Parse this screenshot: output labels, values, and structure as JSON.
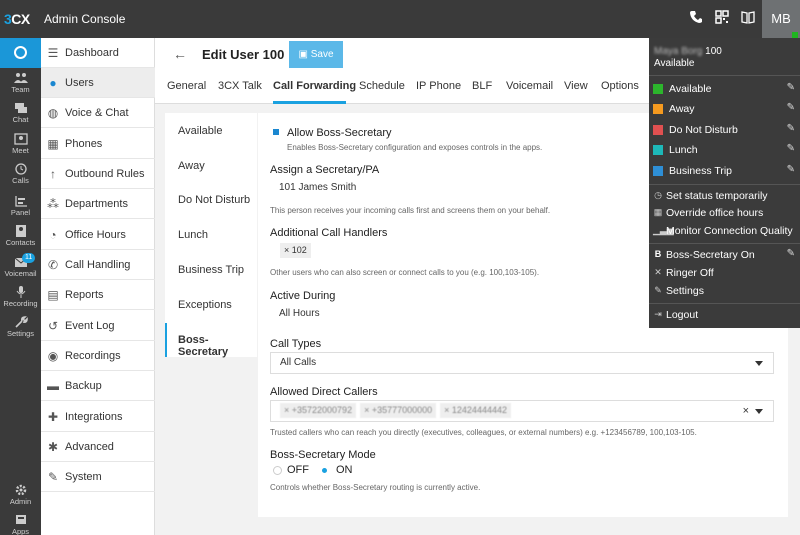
{
  "app": {
    "brand_prefix": "3",
    "brand_suffix": "CX",
    "title": "Admin Console",
    "avatar_initials": "MB"
  },
  "rail": [
    {
      "label": "Team",
      "icon": "team-icon"
    },
    {
      "label": "Chat",
      "icon": "chat-icon"
    },
    {
      "label": "Meet",
      "icon": "meet-icon"
    },
    {
      "label": "Calls",
      "icon": "calls-icon"
    },
    {
      "label": "Panel",
      "icon": "panel-icon"
    },
    {
      "label": "Contacts",
      "icon": "contacts-icon"
    },
    {
      "label": "Voicemail",
      "icon": "voicemail-icon",
      "badge": "11"
    },
    {
      "label": "Recording",
      "icon": "recording-icon"
    },
    {
      "label": "Settings",
      "icon": "settings-icon"
    },
    {
      "label": "Admin",
      "icon": "admin-icon"
    },
    {
      "label": "Apps",
      "icon": "apps-icon"
    }
  ],
  "sidebar": [
    {
      "label": "Dashboard",
      "icon": "dashboard-icon"
    },
    {
      "label": "Users",
      "icon": "user-icon",
      "active": true
    },
    {
      "label": "Voice & Chat",
      "icon": "globe-icon"
    },
    {
      "label": "Phones",
      "icon": "phones-icon"
    },
    {
      "label": "Outbound Rules",
      "icon": "arrow-up-icon"
    },
    {
      "label": "Departments",
      "icon": "departments-icon"
    },
    {
      "label": "Office Hours",
      "icon": "clock-icon"
    },
    {
      "label": "Call Handling",
      "icon": "phone-icon"
    },
    {
      "label": "Reports",
      "icon": "reports-icon"
    },
    {
      "label": "Event Log",
      "icon": "history-icon"
    },
    {
      "label": "Recordings",
      "icon": "record-icon"
    },
    {
      "label": "Backup",
      "icon": "backup-icon"
    },
    {
      "label": "Integrations",
      "icon": "puzzle-icon"
    },
    {
      "label": "Advanced",
      "icon": "gear-icon"
    },
    {
      "label": "System",
      "icon": "wrench-icon"
    }
  ],
  "header": {
    "title": "Edit User 100",
    "save_label": "Save"
  },
  "tabs": [
    "General",
    "3CX Talk",
    "Call Forwarding",
    "Schedule",
    "IP Phone",
    "BLF",
    "Voicemail",
    "View",
    "Options"
  ],
  "active_tab": "Call Forwarding",
  "subtabs": [
    "Available",
    "Away",
    "Do Not Disturb",
    "Lunch",
    "Business Trip",
    "Exceptions",
    "Boss-Secretary"
  ],
  "active_subtab": "Boss-Secretary",
  "form": {
    "allow_label": "Allow Boss-Secretary",
    "allow_hint": "Enables Boss-Secretary configuration and exposes controls in the apps.",
    "secretary_label": "Assign a Secretary/PA",
    "secretary_value": "101  James Smith",
    "secretary_hint": "This person receives your incoming calls first and screens them on your behalf.",
    "handlers_label": "Additional Call Handlers",
    "handlers_chip": "× 102",
    "handlers_hint": "Other users who can also screen or connect calls to you (e.g. 100,103-105).",
    "active_label": "Active During",
    "active_value": "All Hours",
    "call_types_label": "Call Types",
    "call_types_value": "All Calls",
    "direct_label": "Allowed Direct Callers",
    "direct_chips": [
      "× +35722000792",
      "× +35777000000",
      "× 12424444442"
    ],
    "direct_clear": "×",
    "direct_hint": "Trusted callers who can reach you directly (executives, colleagues, or external numbers) e.g. +123456789, 100,103-105.",
    "mode_label": "Boss-Secretary Mode",
    "mode_off": "OFF",
    "mode_on": "ON",
    "mode_selected": "ON",
    "mode_hint": "Controls whether Boss-Secretary routing is currently active."
  },
  "status_menu": {
    "user_name": "Maya Borg",
    "user_ext": "100",
    "current_status": "Available",
    "statuses": [
      {
        "label": "Available",
        "color": "#2cb52c"
      },
      {
        "label": "Away",
        "color": "#f59a1f"
      },
      {
        "label": "Do Not Disturb",
        "color": "#e05050"
      },
      {
        "label": "Lunch",
        "color": "#1db8b8"
      },
      {
        "label": "Business Trip",
        "color": "#2e8fd6"
      }
    ],
    "actions": [
      {
        "label": "Set status temporarily",
        "icon": "clock-icon"
      },
      {
        "label": "Override office hours",
        "icon": "calendar-icon"
      },
      {
        "label": "Monitor Connection Quality",
        "icon": "signal-icon"
      }
    ],
    "toggles": [
      {
        "label": "Boss-Secretary On",
        "icon": "b-icon",
        "editable": true
      },
      {
        "label": "Ringer Off",
        "icon": "bell-off-icon"
      },
      {
        "label": "Settings",
        "icon": "wrench-icon"
      }
    ],
    "logout_label": "Logout"
  }
}
